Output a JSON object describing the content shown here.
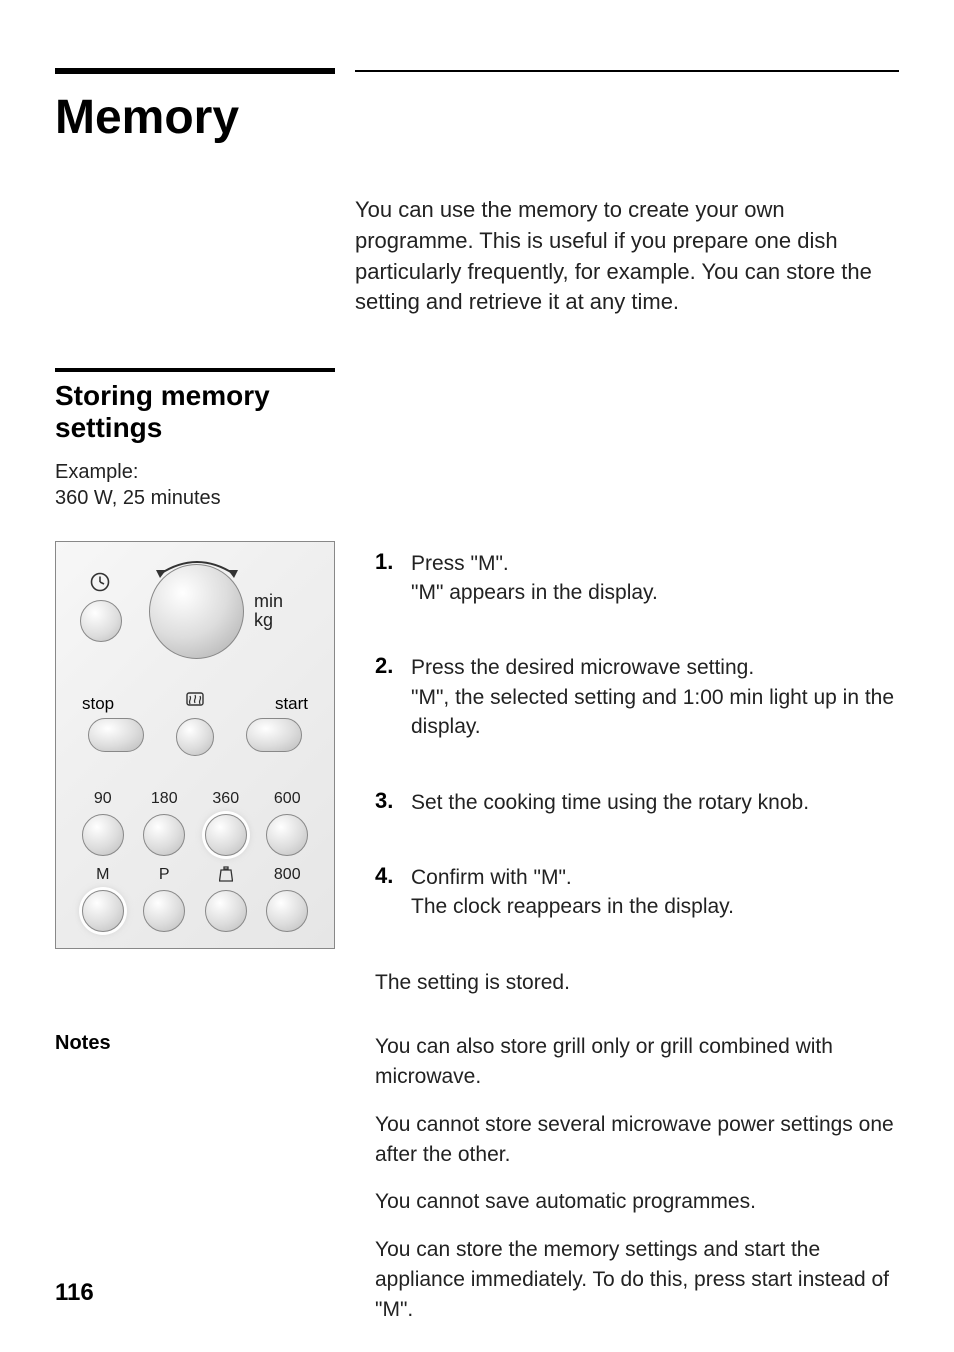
{
  "page": {
    "title": "Memory",
    "intro": "You can use the memory to create your own programme. This is useful if you prepare one dish particularly frequently, for example. You can store the setting and retrieve it at any time.",
    "page_number": "116"
  },
  "section": {
    "title_line1": "Storing memory",
    "title_line2": "settings",
    "example_line1": "Example:",
    "example_line2": "360 W, 25 minutes"
  },
  "panel": {
    "min_label": "min",
    "kg_label": "kg",
    "stop": "stop",
    "start": "start",
    "row3": {
      "a": "90",
      "b": "180",
      "c": "360",
      "d": "600"
    },
    "row4": {
      "a": "M",
      "b": "P",
      "d": "800"
    }
  },
  "steps": [
    {
      "num": "1.",
      "line1": "Press \"M\".",
      "line2": "\"M\" appears in the display."
    },
    {
      "num": "2.",
      "line1": "Press the desired microwave setting.",
      "line2": "\"M\", the selected setting and 1:00 min light up in the display."
    },
    {
      "num": "3.",
      "line1": "Set the cooking time using the rotary knob.",
      "line2": ""
    },
    {
      "num": "4.",
      "line1": "Confirm with \"M\".",
      "line2": "The clock reappears in the display."
    }
  ],
  "stored": "The setting is stored.",
  "notes": {
    "label": "Notes",
    "items": [
      "You can also store grill only or grill combined with microwave.",
      "You cannot store several microwave power settings one after the other.",
      "You cannot save automatic programmes.",
      "You can store the memory settings and start the appliance immediately. To do this, press start instead of \"M\"."
    ]
  }
}
